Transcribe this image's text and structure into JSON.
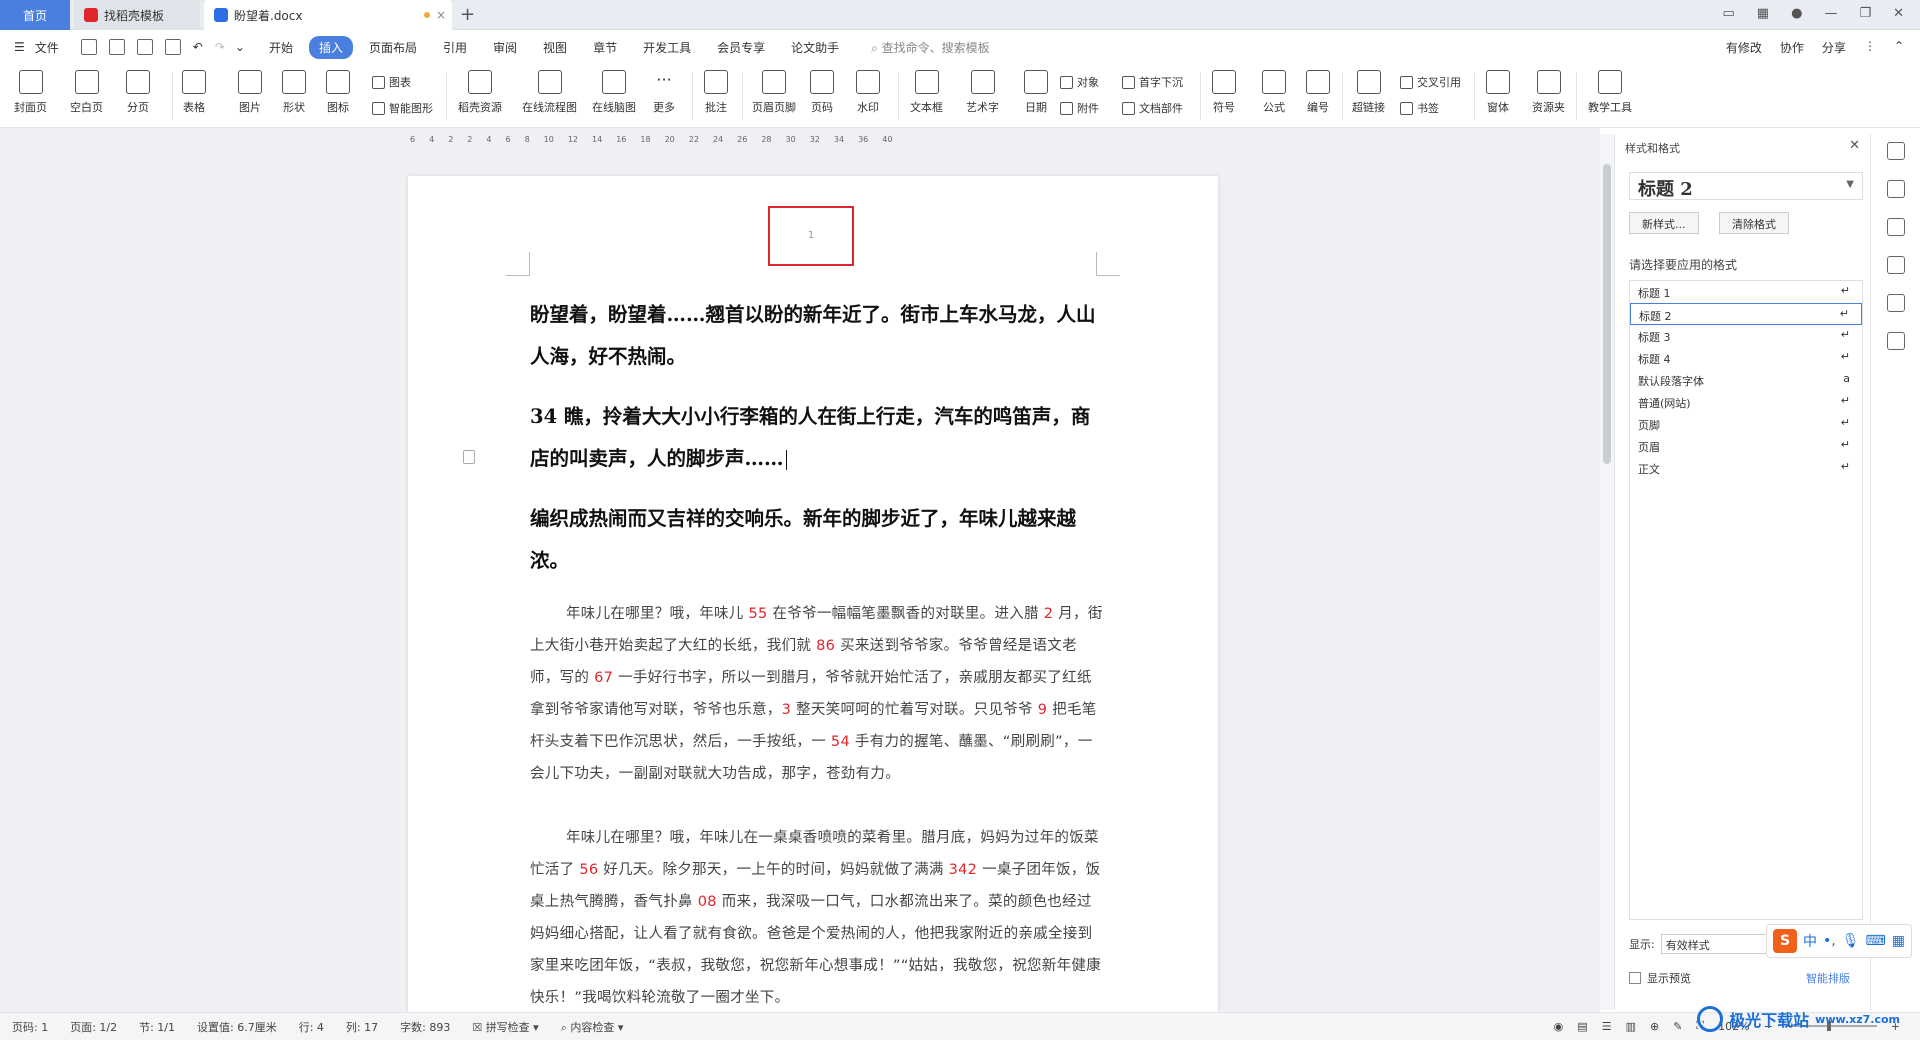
{
  "tabs": {
    "home": "首页",
    "template": "找稻壳模板",
    "doc": "盼望着.docx"
  },
  "menu": {
    "file": "文件",
    "items": [
      "开始",
      "插入",
      "页面布局",
      "引用",
      "审阅",
      "视图",
      "章节",
      "开发工具",
      "会员专享",
      "论文助手"
    ],
    "search": "查找命令、搜索模板",
    "right": [
      "有修改",
      "协作",
      "分享"
    ]
  },
  "ribbon": {
    "big": [
      "封面页",
      "空白页",
      "分页",
      "表格",
      "图片",
      "形状",
      "图标",
      "稻壳资源",
      "在线流程图",
      "在线脑图",
      "更多",
      "批注",
      "页眉页脚",
      "页码",
      "水印",
      "文本框",
      "艺术字",
      "日期",
      "符号",
      "公式",
      "编号",
      "超链接",
      "窗体",
      "资源夹",
      "教学工具"
    ],
    "small": [
      "图表",
      "智能图形",
      "对象",
      "附件",
      "首字下沉",
      "文档部件",
      "交叉引用",
      "书签"
    ]
  },
  "document": {
    "page_number": "1",
    "heading1": "盼望着，盼望着……翘首以盼的新年近了。街市上车水马龙，人山人海，好不热闹。",
    "heading2": "34 瞧，拎着大大小小行李箱的人在街上行走，汽车的鸣笛声，商店的叫卖声，人的脚步声……",
    "heading3": "编织成热闹而又吉祥的交响乐。新年的脚步近了，年味儿越来越浓。",
    "para1": [
      "年味儿在哪里？哦，年味儿 ",
      "55",
      " 在爷爷一幅幅笔墨飘香的对联里。进入腊 ",
      "2",
      " 月，街上大街小巷开始卖起了大红的长纸，我们就 ",
      "86",
      " 买来送到爷爷家。爷爷曾经是语文老师，写的 ",
      "67",
      " 一手好行书字，所以一到腊月，爷爷就开始忙活了，亲戚朋友都买了红纸拿到爷爷家请他写对联，爷爷也乐意，",
      "3",
      " 整天笑呵呵的忙着写对联。只见爷爷 ",
      "9",
      " 把毛笔杆头支着下巴作沉思状，然后，一手按纸，一 ",
      "54",
      " 手有力的握笔、蘸墨、“刷刷刷”，一会儿下功夫，一副副对联就大功告成，那字，苍劲有力。"
    ],
    "para2": [
      "年味儿在哪里？哦，年味儿在一桌桌香喷喷的菜肴里。腊月底，妈妈为过年的饭菜忙活了 ",
      "56",
      " 好几天。除夕那天，一上午的时间，妈妈就做了满满 ",
      "342",
      " 一桌子团年饭，饭桌上热气腾腾，香气扑鼻 ",
      "08",
      " 而来，我深吸一口气，口水都流出来了。菜的颜色也经过妈妈细心搭配，让人看了就有食欲。爸爸是个爱热闹的人，他把我家附近的亲戚全接到家里来吃团年饭，“表叔，我敬您，祝您新年心想事成！”“姑姑，我敬您，祝您新年健康快乐！”我喝饮料轮流敬了一圈才坐下。"
    ]
  },
  "panel": {
    "title": "样式和格式",
    "current_style": "标题  2",
    "new_style": "新样式...",
    "clear_format": "清除格式",
    "label": "请选择要应用的格式",
    "styles": [
      "标题 1",
      "标题 2",
      "标题 3",
      "标题 4",
      "默认段落字体",
      "普通(网站)",
      "页脚",
      "页眉",
      "正文"
    ],
    "show_label": "显示:",
    "show_value": "有效样式",
    "preview": "显示预览",
    "smart_layout": "智能排版"
  },
  "status": {
    "page": "页码: 1",
    "pages": "页面: 1/2",
    "section": "节: 1/1",
    "setting": "设置值: 6.7厘米",
    "row": "行: 4",
    "col": "列: 17",
    "words": "字数: 893",
    "spell": "拼写检查",
    "content": "内容检查",
    "zoom": "102%"
  },
  "watermark": {
    "text": "极光下载站",
    "url": "www.xz7.com"
  },
  "ime": {
    "lang": "中"
  },
  "colors": {
    "accent": "#4a7fe0",
    "highlight": "#e0262c"
  }
}
